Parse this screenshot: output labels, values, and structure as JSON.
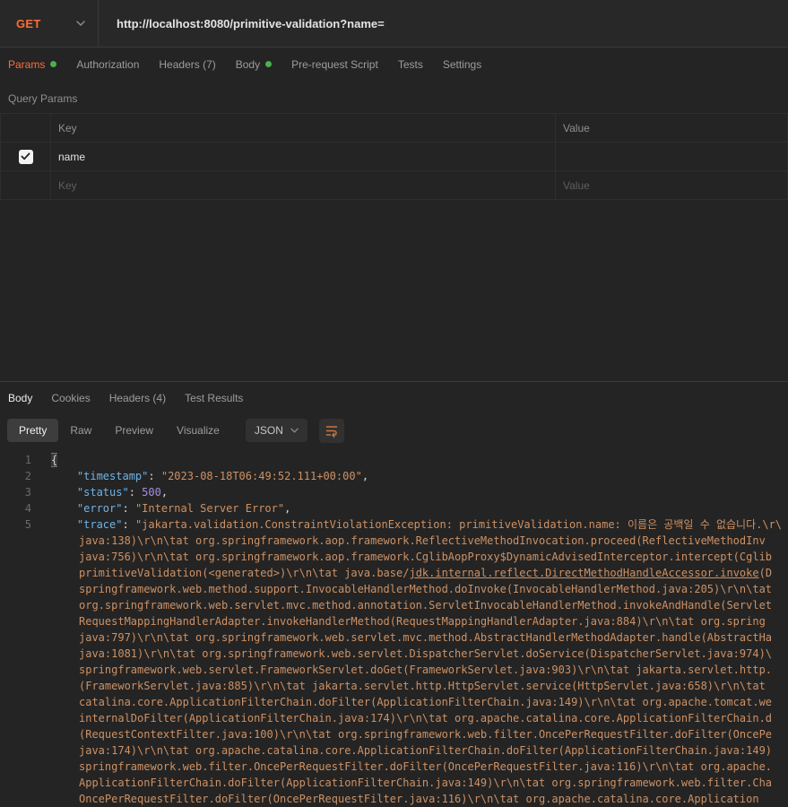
{
  "colors": {
    "accent": "#ff6c37",
    "indicator_green": "#4caf50",
    "json_key": "#6fb3e6",
    "json_string": "#ce9164",
    "json_number": "#a48fe0",
    "wrap_icon": "#c9763f"
  },
  "request": {
    "method": "GET",
    "url": "http://localhost:8080/primitive-validation?name=",
    "tabs": [
      {
        "label": "Params"
      },
      {
        "label": "Authorization"
      },
      {
        "label": "Headers (7)"
      },
      {
        "label": "Body"
      },
      {
        "label": "Pre-request Script"
      },
      {
        "label": "Tests"
      },
      {
        "label": "Settings"
      }
    ]
  },
  "query_params": {
    "title": "Query Params",
    "columns": {
      "key": "Key",
      "value": "Value"
    },
    "rows": [
      {
        "key": "name",
        "value": "",
        "checked": true
      }
    ],
    "placeholders": {
      "key": "Key",
      "value": "Value"
    }
  },
  "response": {
    "tabs": [
      {
        "label": "Body"
      },
      {
        "label": "Cookies"
      },
      {
        "label": "Headers (4)"
      },
      {
        "label": "Test Results"
      }
    ],
    "view_tabs": [
      {
        "label": "Pretty"
      },
      {
        "label": "Raw"
      },
      {
        "label": "Preview"
      },
      {
        "label": "Visualize"
      }
    ],
    "language": "JSON"
  },
  "response_body": {
    "lines": [
      {
        "n": "1",
        "seg": [
          [
            "b",
            "{"
          ]
        ]
      },
      {
        "n": "2",
        "seg": [
          [
            "w",
            "    "
          ],
          [
            "k",
            "\"timestamp\""
          ],
          [
            "w",
            ": "
          ],
          [
            "s",
            "\"2023-08-18T06:49:52.111+00:00\""
          ],
          [
            "w",
            ","
          ]
        ]
      },
      {
        "n": "3",
        "seg": [
          [
            "w",
            "    "
          ],
          [
            "k",
            "\"status\""
          ],
          [
            "w",
            ": "
          ],
          [
            "n",
            "500"
          ],
          [
            "w",
            ","
          ]
        ]
      },
      {
        "n": "4",
        "seg": [
          [
            "w",
            "    "
          ],
          [
            "k",
            "\"error\""
          ],
          [
            "w",
            ": "
          ],
          [
            "s",
            "\"Internal Server Error\""
          ],
          [
            "w",
            ","
          ]
        ]
      },
      {
        "n": "5",
        "seg": [
          [
            "w",
            "    "
          ],
          [
            "k",
            "\"trace\""
          ],
          [
            "w",
            ": "
          ],
          [
            "s",
            "\"jakarta.validation.ConstraintViolationException: primitiveValidation.name: 이름은 공백일 수 없습니다.\\r\\"
          ]
        ]
      },
      {
        "n": "",
        "seg": [
          [
            "s",
            "java:138)\\r\\n\\tat org.springframework.aop.framework.ReflectiveMethodInvocation.proceed(ReflectiveMethodInv"
          ]
        ]
      },
      {
        "n": "",
        "seg": [
          [
            "s",
            "java:756)\\r\\n\\tat org.springframework.aop.framework.CglibAopProxy$DynamicAdvisedInterceptor.intercept(Cglib"
          ]
        ]
      },
      {
        "n": "",
        "seg": [
          [
            "s",
            "primitiveValidation(<generated>)\\r\\n\\tat java.base/"
          ],
          [
            "u",
            "jdk.internal.reflect.DirectMethodHandleAccessor.invoke"
          ],
          [
            "s",
            "(D"
          ]
        ]
      },
      {
        "n": "",
        "seg": [
          [
            "s",
            "springframework.web.method.support.InvocableHandlerMethod.doInvoke(InvocableHandlerMethod.java:205)\\r\\n\\tat"
          ]
        ]
      },
      {
        "n": "",
        "seg": [
          [
            "s",
            "org.springframework.web.servlet.mvc.method.annotation.ServletInvocableHandlerMethod.invokeAndHandle(Servlet"
          ]
        ]
      },
      {
        "n": "",
        "seg": [
          [
            "s",
            "RequestMappingHandlerAdapter.invokeHandlerMethod(RequestMappingHandlerAdapter.java:884)\\r\\n\\tat org.spring"
          ]
        ]
      },
      {
        "n": "",
        "seg": [
          [
            "s",
            "java:797)\\r\\n\\tat org.springframework.web.servlet.mvc.method.AbstractHandlerMethodAdapter.handle(AbstractHa"
          ]
        ]
      },
      {
        "n": "",
        "seg": [
          [
            "s",
            "java:1081)\\r\\n\\tat org.springframework.web.servlet.DispatcherServlet.doService(DispatcherServlet.java:974)\\"
          ]
        ]
      },
      {
        "n": "",
        "seg": [
          [
            "s",
            "springframework.web.servlet.FrameworkServlet.doGet(FrameworkServlet.java:903)\\r\\n\\tat jakarta.servlet.http."
          ]
        ]
      },
      {
        "n": "",
        "seg": [
          [
            "s",
            "(FrameworkServlet.java:885)\\r\\n\\tat jakarta.servlet.http.HttpServlet.service(HttpServlet.java:658)\\r\\n\\tat "
          ]
        ]
      },
      {
        "n": "",
        "seg": [
          [
            "s",
            "catalina.core.ApplicationFilterChain.doFilter(ApplicationFilterChain.java:149)\\r\\n\\tat org.apache.tomcat.we"
          ]
        ]
      },
      {
        "n": "",
        "seg": [
          [
            "s",
            "internalDoFilter(ApplicationFilterChain.java:174)\\r\\n\\tat org.apache.catalina.core.ApplicationFilterChain.d"
          ]
        ]
      },
      {
        "n": "",
        "seg": [
          [
            "s",
            "(RequestContextFilter.java:100)\\r\\n\\tat org.springframework.web.filter.OncePerRequestFilter.doFilter(OncePe"
          ]
        ]
      },
      {
        "n": "",
        "seg": [
          [
            "s",
            "java:174)\\r\\n\\tat org.apache.catalina.core.ApplicationFilterChain.doFilter(ApplicationFilterChain.java:149)"
          ]
        ]
      },
      {
        "n": "",
        "seg": [
          [
            "s",
            "springframework.web.filter.OncePerRequestFilter.doFilter(OncePerRequestFilter.java:116)\\r\\n\\tat org.apache."
          ]
        ]
      },
      {
        "n": "",
        "seg": [
          [
            "s",
            "ApplicationFilterChain.doFilter(ApplicationFilterChain.java:149)\\r\\n\\tat org.springframework.web.filter.Cha"
          ]
        ]
      },
      {
        "n": "",
        "seg": [
          [
            "s",
            "OncePerRequestFilter.doFilter(OncePerRequestFilter.java:116)\\r\\n\\tat org.apache.catalina.core.Application"
          ]
        ]
      }
    ]
  }
}
